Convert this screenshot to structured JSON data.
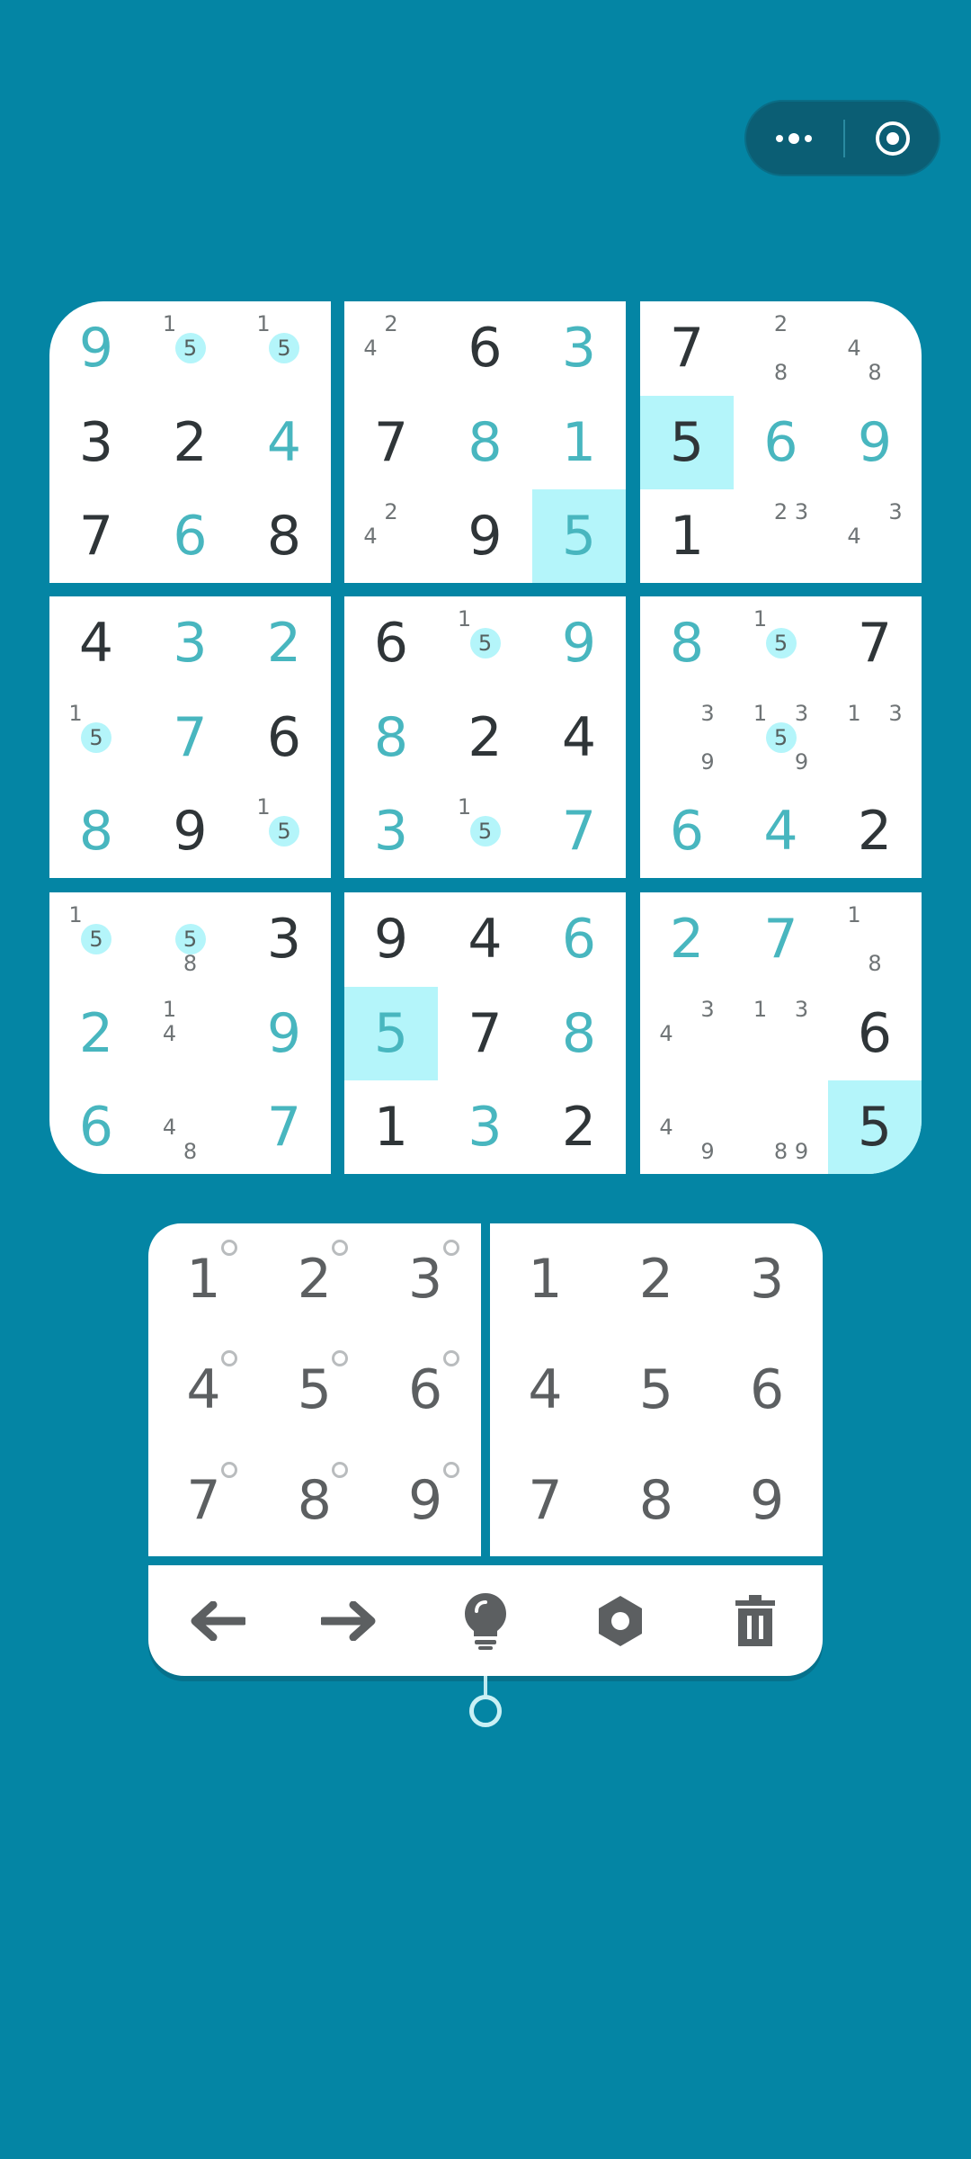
{
  "capsule": {
    "more_icon": "more-dots-icon",
    "close_icon": "target-circle-icon"
  },
  "colors": {
    "background": "#0485a4",
    "given": "#2f3538",
    "user": "#48b6bf",
    "highlight": "#b4f5fa",
    "note": "#6f7476"
  },
  "board": {
    "cells": [
      [
        {
          "v": "9",
          "t": "u"
        },
        {
          "n": [
            "1",
            "5"
          ]
        },
        {
          "n": [
            "1",
            "5"
          ]
        },
        {
          "n": [
            "4",
            "2"
          ]
        },
        {
          "v": "6",
          "t": "g"
        },
        {
          "v": "3",
          "t": "u"
        },
        {
          "v": "7",
          "t": "g"
        },
        {
          "n": [
            "2",
            "8"
          ]
        },
        {
          "n": [
            "4",
            "8"
          ]
        }
      ],
      [
        {
          "v": "3",
          "t": "g"
        },
        {
          "v": "2",
          "t": "g"
        },
        {
          "v": "4",
          "t": "u"
        },
        {
          "v": "7",
          "t": "g"
        },
        {
          "v": "8",
          "t": "u"
        },
        {
          "v": "1",
          "t": "u"
        },
        {
          "v": "5",
          "t": "g",
          "hl": true
        },
        {
          "v": "6",
          "t": "u"
        },
        {
          "v": "9",
          "t": "u"
        }
      ],
      [
        {
          "v": "7",
          "t": "g"
        },
        {
          "v": "6",
          "t": "u"
        },
        {
          "v": "8",
          "t": "g"
        },
        {
          "n": [
            "4",
            "2"
          ]
        },
        {
          "v": "9",
          "t": "g"
        },
        {
          "v": "5",
          "t": "u",
          "hl": true
        },
        {
          "v": "1",
          "t": "g"
        },
        {
          "n": [
            "2",
            "3"
          ]
        },
        {
          "n": [
            "4",
            "3"
          ]
        }
      ],
      [
        {
          "v": "4",
          "t": "g"
        },
        {
          "v": "3",
          "t": "u"
        },
        {
          "v": "2",
          "t": "u"
        },
        {
          "v": "6",
          "t": "g"
        },
        {
          "n": [
            "1",
            "5"
          ]
        },
        {
          "v": "9",
          "t": "u"
        },
        {
          "v": "8",
          "t": "u"
        },
        {
          "n": [
            "1",
            "5"
          ]
        },
        {
          "v": "7",
          "t": "g"
        }
      ],
      [
        {
          "n": [
            "1",
            "5"
          ]
        },
        {
          "v": "7",
          "t": "u"
        },
        {
          "v": "6",
          "t": "g"
        },
        {
          "v": "8",
          "t": "u"
        },
        {
          "v": "2",
          "t": "g"
        },
        {
          "v": "4",
          "t": "g"
        },
        {
          "n": [
            "3",
            "9"
          ]
        },
        {
          "n": [
            "1",
            "3",
            "5",
            "9"
          ]
        },
        {
          "n": [
            "1",
            "3"
          ]
        }
      ],
      [
        {
          "v": "8",
          "t": "u"
        },
        {
          "v": "9",
          "t": "g"
        },
        {
          "n": [
            "1",
            "5"
          ]
        },
        {
          "v": "3",
          "t": "u"
        },
        {
          "n": [
            "1",
            "5"
          ]
        },
        {
          "v": "7",
          "t": "u"
        },
        {
          "v": "6",
          "t": "u"
        },
        {
          "v": "4",
          "t": "u"
        },
        {
          "v": "2",
          "t": "g"
        }
      ],
      [
        {
          "n": [
            "1",
            "5"
          ]
        },
        {
          "n": [
            "5",
            "8"
          ]
        },
        {
          "v": "3",
          "t": "g"
        },
        {
          "v": "9",
          "t": "g"
        },
        {
          "v": "4",
          "t": "g"
        },
        {
          "v": "6",
          "t": "u"
        },
        {
          "v": "2",
          "t": "u"
        },
        {
          "v": "7",
          "t": "u"
        },
        {
          "n": [
            "1",
            "8"
          ]
        }
      ],
      [
        {
          "v": "2",
          "t": "u"
        },
        {
          "n": [
            "1",
            "4"
          ]
        },
        {
          "v": "9",
          "t": "u"
        },
        {
          "v": "5",
          "t": "u",
          "hl": true
        },
        {
          "v": "7",
          "t": "g"
        },
        {
          "v": "8",
          "t": "u"
        },
        {
          "n": [
            "4",
            "3"
          ]
        },
        {
          "n": [
            "1",
            "3"
          ]
        },
        {
          "v": "6",
          "t": "g"
        }
      ],
      [
        {
          "v": "6",
          "t": "u"
        },
        {
          "n": [
            "4",
            "8"
          ]
        },
        {
          "v": "7",
          "t": "u"
        },
        {
          "v": "1",
          "t": "g"
        },
        {
          "v": "3",
          "t": "u"
        },
        {
          "v": "2",
          "t": "g"
        },
        {
          "n": [
            "4",
            "9"
          ]
        },
        {
          "n": [
            "8",
            "9"
          ]
        },
        {
          "v": "5",
          "t": "g",
          "hl": true
        }
      ]
    ],
    "highlighted_notes": [
      "5"
    ]
  },
  "pencil_pad": {
    "keys": [
      "1",
      "2",
      "3",
      "4",
      "5",
      "6",
      "7",
      "8",
      "9"
    ]
  },
  "number_pad": {
    "keys": [
      "1",
      "2",
      "3",
      "4",
      "5",
      "6",
      "7",
      "8",
      "9"
    ]
  },
  "toolbar": {
    "tools": [
      "undo-arrow-icon",
      "redo-arrow-icon",
      "hint-bulb-icon",
      "settings-gear-icon",
      "delete-trash-icon"
    ]
  }
}
